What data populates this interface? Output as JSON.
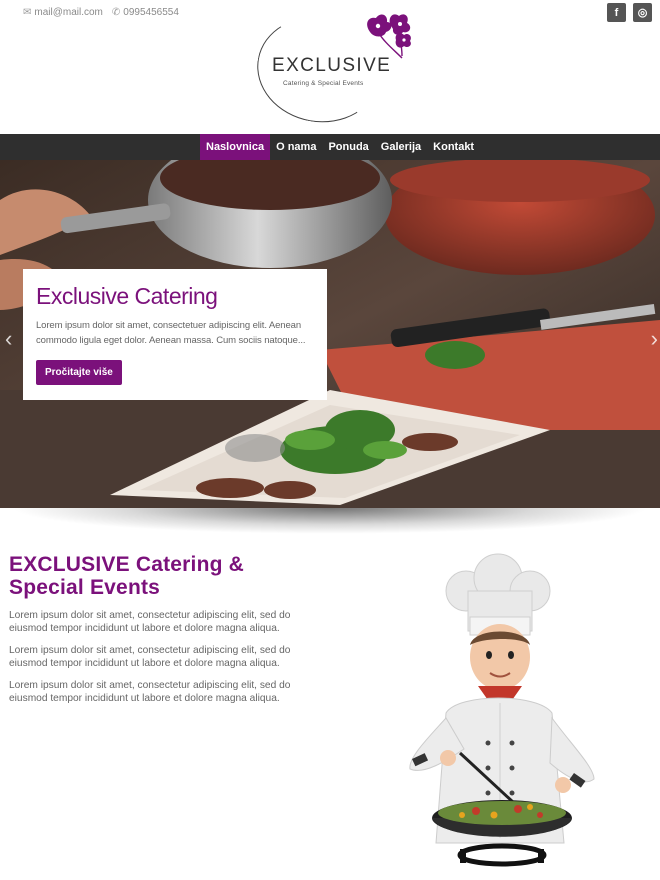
{
  "header": {
    "email": "mail@mail.com",
    "phone": "0995456554",
    "social": [
      {
        "icon": "facebook-icon",
        "glyph": "f"
      },
      {
        "icon": "instagram-icon",
        "glyph": "◎"
      }
    ]
  },
  "logo": {
    "brand": "EXCLUSIVE",
    "tagline": "Catering & Special Events"
  },
  "nav": {
    "items": [
      {
        "label": "Naslovnica",
        "active": true
      },
      {
        "label": "O nama",
        "active": false
      },
      {
        "label": "Ponuda",
        "active": false
      },
      {
        "label": "Galerija",
        "active": false
      },
      {
        "label": "Kontakt",
        "active": false
      }
    ]
  },
  "hero": {
    "title": "Exclusive Catering",
    "text": "Lorem ipsum dolor sit amet, consectetuer adipiscing elit. Aenean commodo ligula eget dolor. Aenean massa. Cum sociis natoque...",
    "button": "Pročitajte više",
    "prev_icon": "chevron-left-icon",
    "next_icon": "chevron-right-icon"
  },
  "about": {
    "title": "EXCLUSIVE Catering & Special Events",
    "paragraphs": [
      "Lorem ipsum dolor sit amet, consectetur adipiscing elit, sed do eiusmod tempor incididunt ut labore et dolore magna aliqua.",
      "Lorem ipsum dolor sit amet, consectetur adipiscing elit, sed do eiusmod tempor incididunt ut labore et dolore magna aliqua.",
      "Lorem ipsum dolor sit amet, consectetur adipiscing elit, sed do eiusmod tempor incididunt ut labore et dolore magna aliqua."
    ]
  },
  "colors": {
    "accent": "#7b117b",
    "nav_bg": "#2f2f2f"
  }
}
